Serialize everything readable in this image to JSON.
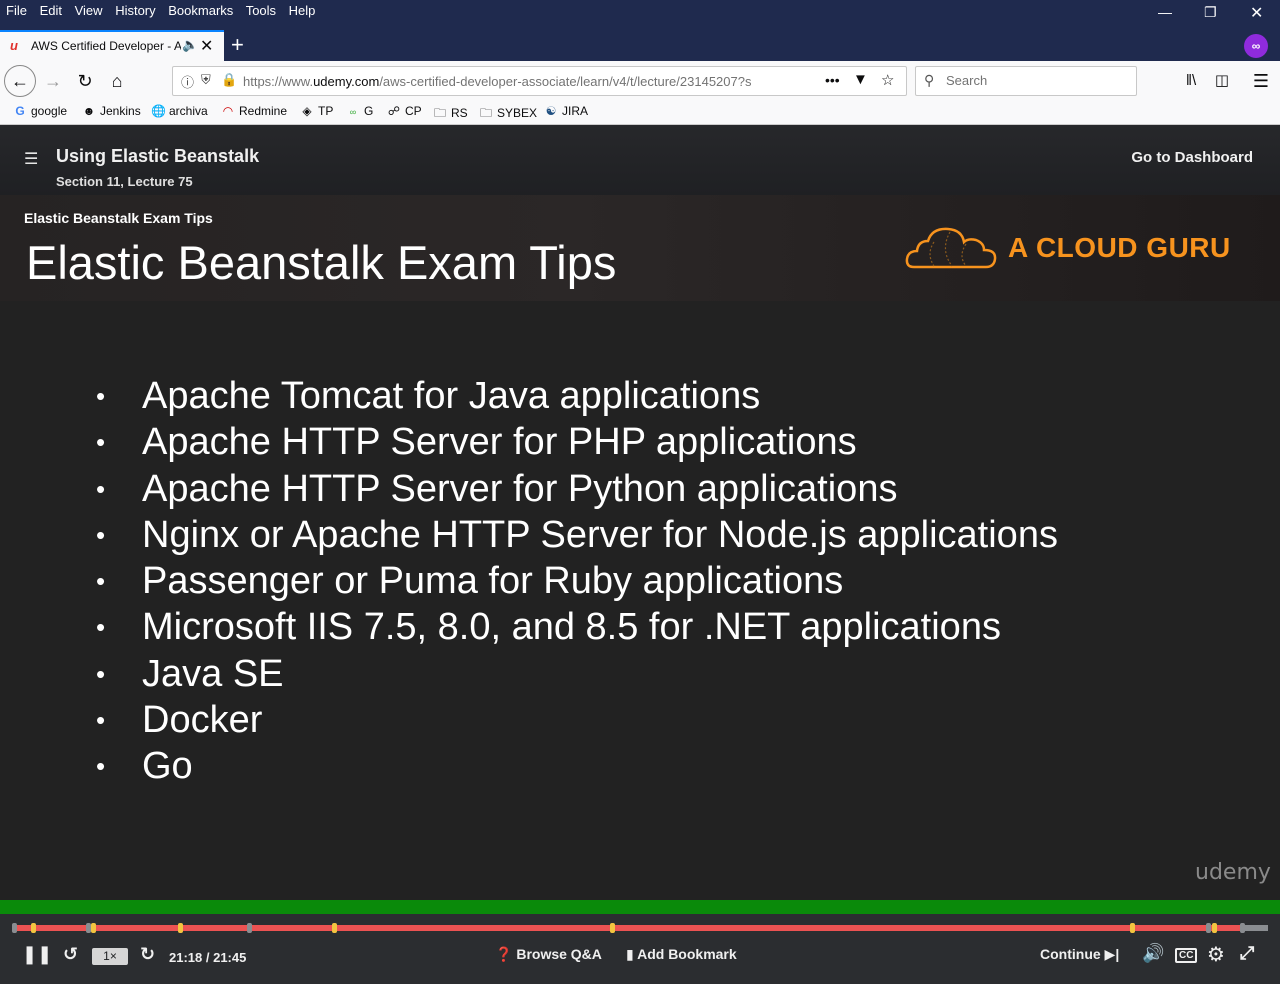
{
  "browser": {
    "menu": [
      "File",
      "Edit",
      "View",
      "History",
      "Bookmarks",
      "Tools",
      "Help"
    ],
    "tab_title": "AWS Certified Developer - A",
    "url_prefix": "https://www.",
    "url_domain": "udemy.com",
    "url_path": "/aws-certified-developer-associate/learn/v4/t/lecture/23145207?s",
    "search_placeholder": "Search",
    "bookmarks": [
      {
        "label": "google",
        "icon": "google-icon"
      },
      {
        "label": "Jenkins",
        "icon": "jenkins-icon"
      },
      {
        "label": "archiva",
        "icon": "globe-icon"
      },
      {
        "label": "Redmine",
        "icon": "redmine-icon"
      },
      {
        "label": "TP",
        "icon": "diamond-icon"
      },
      {
        "label": "G",
        "icon": "graph-icon"
      },
      {
        "label": "CP",
        "icon": "cp-icon"
      },
      {
        "label": "RS",
        "icon": "folder-icon"
      },
      {
        "label": "SYBEX",
        "icon": "folder-icon"
      },
      {
        "label": "JIRA",
        "icon": "jira-icon"
      }
    ]
  },
  "course": {
    "title": "Using Elastic Beanstalk",
    "subtitle": "Section 11, Lecture 75",
    "dashboard": "Go to Dashboard"
  },
  "slide": {
    "small_title": "Elastic Beanstalk Exam Tips",
    "big_title": "Elastic Beanstalk Exam Tips",
    "brand": "A CLOUD GURU",
    "watermark": "udemy",
    "bullets": [
      "Apache Tomcat for Java applications",
      "Apache HTTP Server for PHP applications",
      "Apache HTTP Server for Python applications",
      "Nginx or Apache HTTP Server for Node.js applications",
      "Passenger or Puma for Ruby applications",
      "Microsoft IIS 7.5, 8.0, and 8.5 for .NET applications",
      "Java SE",
      "Docker",
      "Go"
    ]
  },
  "player": {
    "speed": "1×",
    "time": "21:18 / 21:45",
    "progress": 0.979,
    "browse_qa": "Browse Q&A",
    "add_bookmark": "Add Bookmark",
    "continue": "Continue",
    "cc": "CC",
    "colors": {
      "progress": "#ec5252",
      "bookmark_marker": "#f3c440",
      "green_bar": "#0a8a0a"
    }
  }
}
